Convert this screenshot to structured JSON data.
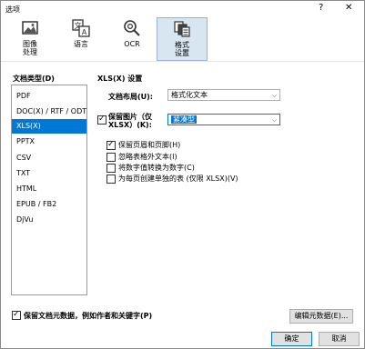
{
  "window": {
    "title": "选项",
    "help": "?",
    "close": "✕"
  },
  "toolbar": {
    "items": [
      {
        "label_line1": "图像",
        "label_line2": "处理"
      },
      {
        "label_line1": "语言",
        "label_line2": ""
      },
      {
        "label_line1": "OCR",
        "label_line2": ""
      },
      {
        "label_line1": "格式",
        "label_line2": "设置"
      }
    ]
  },
  "left": {
    "heading": "文档类型(D)",
    "items": [
      "PDF",
      "DOC(X) / RTF / ODT",
      "XLS(X)",
      "PPTX",
      "CSV",
      "TXT",
      "HTML",
      "EPUB / FB2",
      "DjVu"
    ],
    "selected": "XLS(X)"
  },
  "right": {
    "heading": "XLS(X) 设置",
    "layout_label": "文档布局(U):",
    "layout_value": "格式化文本",
    "keep_images_label_line1": "保留图片（仅",
    "keep_images_label_line2": "XLSX）(K):",
    "image_quality_value": "紧凑型",
    "options": [
      {
        "label": "保留页眉和页脚(H)",
        "checked": true
      },
      {
        "label": "忽略表格外文本(I)",
        "checked": false
      },
      {
        "label": "将数字值转换为数字(C)",
        "checked": false
      },
      {
        "label": "为每页创建单独的表 (仅限 XLSX)(V)",
        "checked": false
      }
    ]
  },
  "bottom": {
    "keep_metadata_label": "保留文档元数据，例如作者和关键字(P)",
    "edit_metadata_button": "编辑元数据(E)...",
    "ok_button": "确定",
    "cancel_button": "取消"
  }
}
